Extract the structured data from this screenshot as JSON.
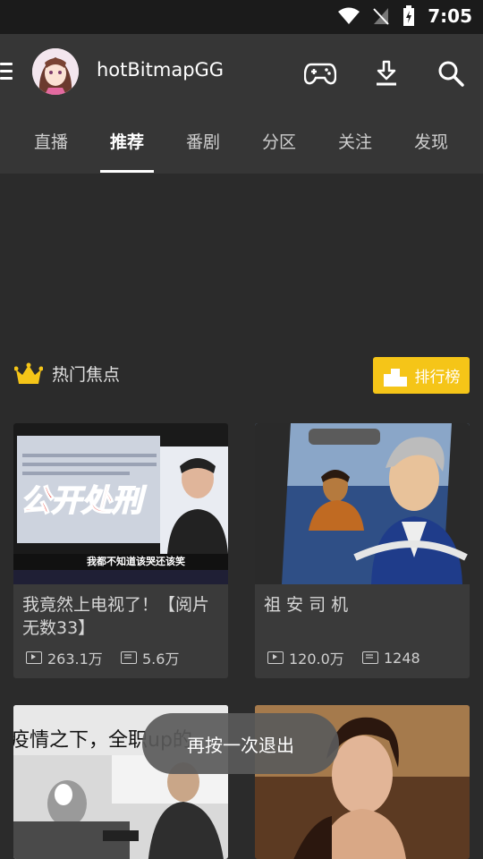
{
  "status_bar": {
    "time": "7:05"
  },
  "header": {
    "username": "hotBitmapGG",
    "icons": [
      "menu-icon",
      "gamepad-icon",
      "download-icon",
      "search-icon"
    ]
  },
  "tabs": [
    {
      "label": "直播"
    },
    {
      "label": "推荐",
      "active": true
    },
    {
      "label": "番剧"
    },
    {
      "label": "分区"
    },
    {
      "label": "关注"
    },
    {
      "label": "发现"
    }
  ],
  "section": {
    "title": "热门焦点",
    "rank_button": "排行榜"
  },
  "cards": [
    {
      "title": "我竟然上电视了！【阅片无数33】",
      "thumb_caption": "公开处刑",
      "thumb_subtitle": "我都不知道该哭还该笑",
      "plays": "263.1万",
      "danmaku": "5.6万"
    },
    {
      "title": "祖 安 司 机",
      "plays": "120.0万",
      "danmaku": "1248"
    },
    {
      "title": "",
      "thumb_caption": "疫情之下，全职up的"
    },
    {
      "title": ""
    }
  ],
  "toast": "再按一次退出",
  "colors": {
    "background": "#2b2b2b",
    "header": "#363636",
    "accent": "#f5c518"
  }
}
